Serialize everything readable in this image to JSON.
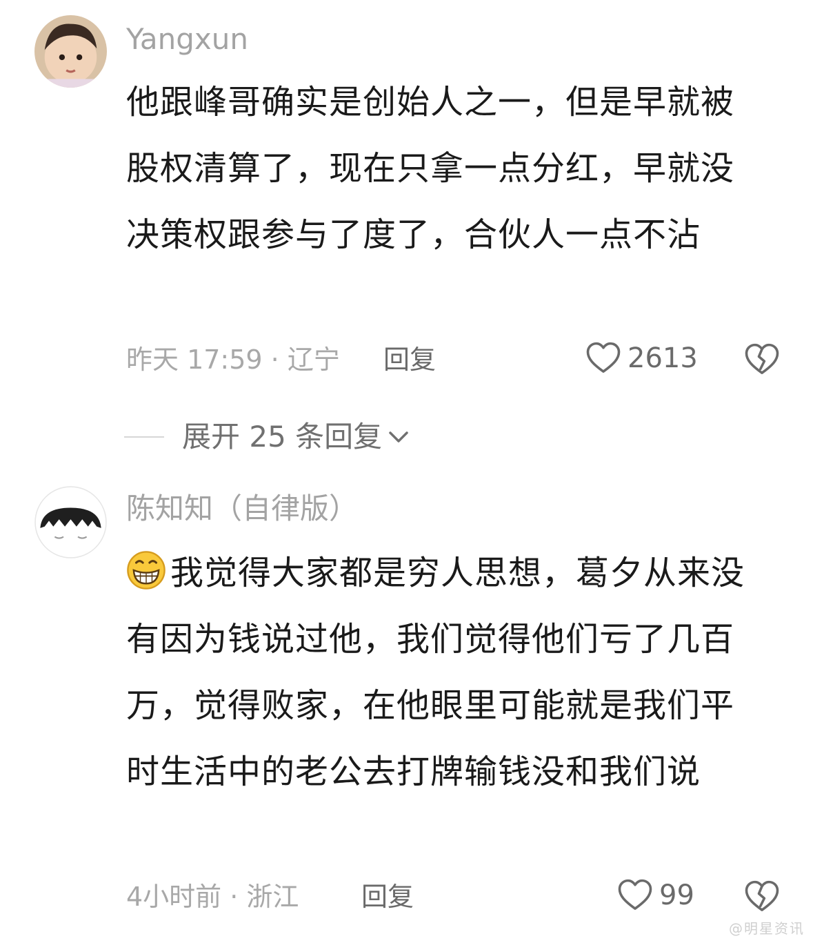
{
  "comments": [
    {
      "username": "Yangxun",
      "text": "他跟峰哥确实是创始人之一，但是早就被股权清算了，现在只拿一点分红，早就没决策权跟参与了度了，合伙人一点不沾",
      "meta": "昨天 17:59 · 辽宁",
      "reply_label": "回复",
      "like_count": "2613"
    },
    {
      "username": "陈知知（自律版）",
      "text": "我觉得大家都是穷人思想，葛夕从来没有因为钱说过他，我们觉得他们亏了几百万，觉得败家，在他眼里可能就是我们平时生活中的老公去打牌输钱没和我们说",
      "meta": "4小时前 · 浙江",
      "reply_label": "回复",
      "like_count": "99"
    }
  ],
  "expand_replies": {
    "label": "展开 25 条回复"
  },
  "icons": {
    "like": "heart-outline-icon",
    "dislike": "broken-heart-icon",
    "expand": "chevron-down-icon",
    "emoji": "grinning-face-icon"
  },
  "watermark": "@明星资讯"
}
